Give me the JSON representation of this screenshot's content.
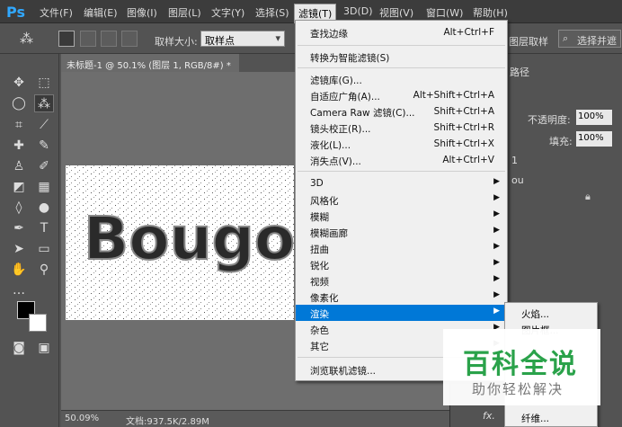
{
  "app": {
    "logo": "Ps"
  },
  "menubar": {
    "items": [
      "文件(F)",
      "编辑(E)",
      "图像(I)",
      "图层(L)",
      "文字(Y)",
      "选择(S)",
      "滤镜(T)",
      "3D(D)",
      "视图(V)",
      "窗口(W)",
      "帮助(H)"
    ],
    "active": "滤镜(T)"
  },
  "options": {
    "sample_size_label": "取样大小:",
    "sample_size_value": "取样点",
    "layer_sample": "图层取样",
    "select_subject": "选择并遮"
  },
  "document": {
    "tab_title": "未标题-1 @ 50.1% (图层 1, RGB/8#) *",
    "canvas_text": "Bougo",
    "zoom": "50.09%",
    "doc_info": "文档:937.5K/2.89M"
  },
  "panels": {
    "paths_tab": "路径",
    "opacity_label": "不透明度:",
    "opacity_value": "100%",
    "fill_label": "填充:",
    "fill_value": "100%",
    "layer_number": "1",
    "layer_partial": "ou",
    "fx_label": "fx."
  },
  "filter_menu": {
    "items": [
      {
        "label": "查找边缘",
        "shortcut": "Alt+Ctrl+F"
      },
      {
        "label": "转换为智能滤镜(S)",
        "shortcut": ""
      },
      {
        "label": "滤镜库(G)...",
        "shortcut": ""
      },
      {
        "label": "自适应广角(A)...",
        "shortcut": "Alt+Shift+Ctrl+A"
      },
      {
        "label": "Camera Raw 滤镜(C)...",
        "shortcut": "Shift+Ctrl+A"
      },
      {
        "label": "镜头校正(R)...",
        "shortcut": "Shift+Ctrl+R"
      },
      {
        "label": "液化(L)...",
        "shortcut": "Shift+Ctrl+X"
      },
      {
        "label": "消失点(V)...",
        "shortcut": "Alt+Ctrl+V"
      },
      {
        "label": "3D",
        "shortcut": ""
      },
      {
        "label": "风格化",
        "shortcut": ""
      },
      {
        "label": "模糊",
        "shortcut": ""
      },
      {
        "label": "模糊画廊",
        "shortcut": ""
      },
      {
        "label": "扭曲",
        "shortcut": ""
      },
      {
        "label": "锐化",
        "shortcut": ""
      },
      {
        "label": "视频",
        "shortcut": ""
      },
      {
        "label": "像素化",
        "shortcut": ""
      },
      {
        "label": "渲染",
        "shortcut": ""
      },
      {
        "label": "杂色",
        "shortcut": ""
      },
      {
        "label": "其它",
        "shortcut": ""
      },
      {
        "label": "浏览联机滤镜...",
        "shortcut": ""
      }
    ],
    "highlighted": "渲染"
  },
  "render_submenu": {
    "items": [
      "火焰...",
      "图片框...",
      "纤维..."
    ]
  },
  "watermark": {
    "title": "百科全说",
    "subtitle": "助你轻松解决"
  },
  "colors": {
    "accent": "#0078d7",
    "watermark_green": "#2aa24a"
  }
}
